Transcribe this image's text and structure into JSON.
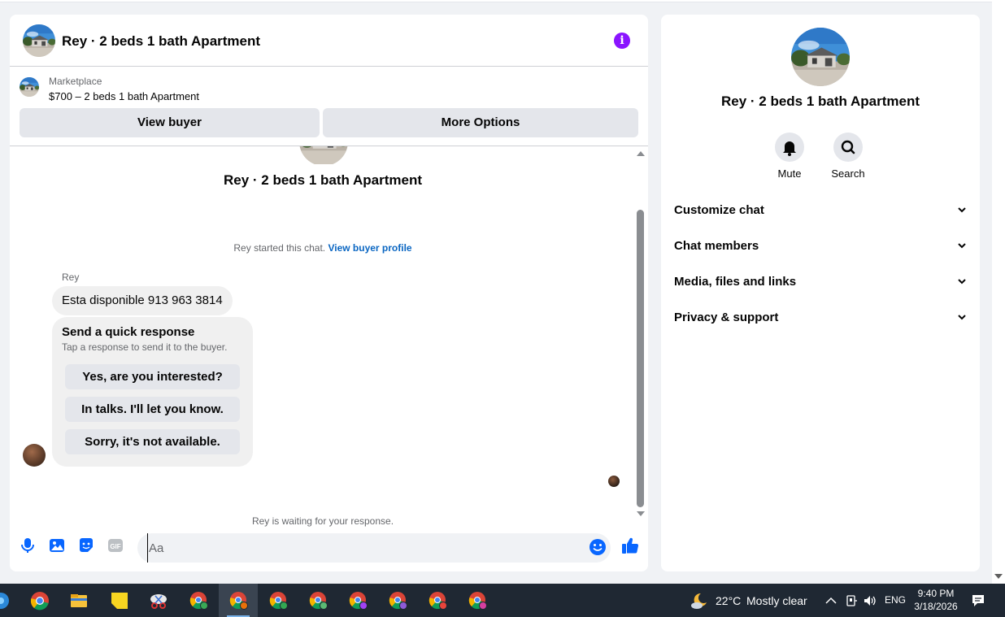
{
  "conversation": {
    "title": "Rey · 2 beds 1 bath Apartment",
    "info_icon": "info-icon"
  },
  "listing": {
    "source": "Marketplace",
    "title": "$700 – 2 beds 1 bath Apartment",
    "view_buyer_label": "View buyer",
    "more_options_label": "More Options"
  },
  "thread": {
    "title": "Rey · 2 beds 1 bath Apartment",
    "started_text": "Rey started this chat.",
    "profile_link": "View buyer profile",
    "sender_name": "Rey",
    "message": "Esta disponible 913 963 3814",
    "quick_response": {
      "title": "Send a quick response",
      "subtitle": "Tap a response to send it to the buyer.",
      "options": [
        "Yes, are you interested?",
        "In talks. I'll let you know.",
        "Sorry, it's not available."
      ]
    },
    "waiting_text": "Rey is waiting for your response."
  },
  "composer": {
    "placeholder": "Aa",
    "gif_label": "GIF",
    "icons": [
      "microphone-icon",
      "photo-icon",
      "sticker-icon",
      "gif-icon",
      "emoji-icon",
      "thumbs-up-icon"
    ]
  },
  "side_panel": {
    "title": "Rey · 2 beds 1 bath Apartment",
    "actions": [
      {
        "label": "Mute",
        "icon": "bell-icon"
      },
      {
        "label": "Search",
        "icon": "search-icon"
      }
    ],
    "sections": [
      "Customize chat",
      "Chat members",
      "Media, files and links",
      "Privacy & support"
    ]
  },
  "taskbar": {
    "weather_temp": "22°C",
    "weather_desc": "Mostly clear",
    "language": "ENG",
    "time": "9:40 PM",
    "date": "3/18/2026"
  },
  "colors": {
    "accent_blue": "#0866ff",
    "info_purple": "#8a14ff",
    "link_blue": "#0a66c2",
    "taskbar": "#1f2833"
  }
}
